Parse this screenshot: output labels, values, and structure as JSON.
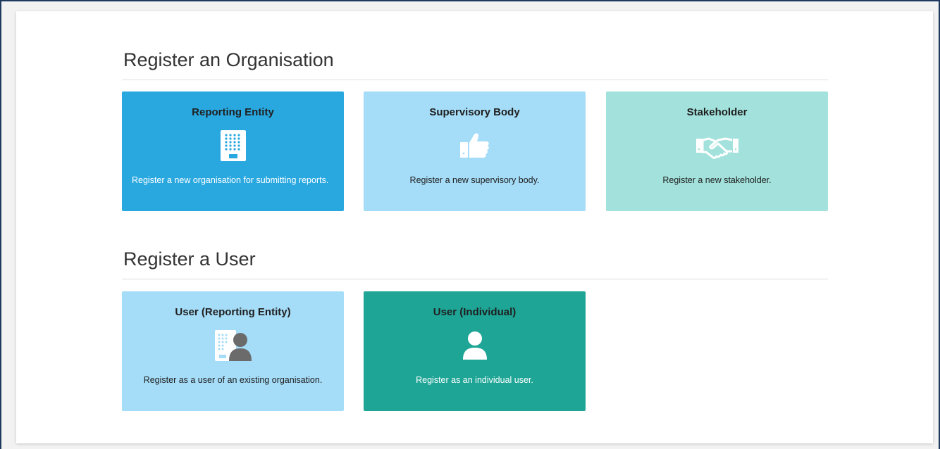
{
  "sections": {
    "organisation": {
      "title": "Register an Organisation",
      "tiles": [
        {
          "title": "Reporting Entity",
          "description": "Register a new organisation for submitting reports.",
          "icon": "building-icon",
          "color": "#29a8e0"
        },
        {
          "title": "Supervisory Body",
          "description": "Register a new supervisory body.",
          "icon": "thumbs-up-icon",
          "color": "#a5dcf7"
        },
        {
          "title": "Stakeholder",
          "description": "Register a new stakeholder.",
          "icon": "handshake-icon",
          "color": "#a3e2dc"
        }
      ]
    },
    "user": {
      "title": "Register a User",
      "tiles": [
        {
          "title": "User (Reporting Entity)",
          "description": "Register as a user of an existing organisation.",
          "icon": "building-user-icon",
          "color": "#a5dcf7"
        },
        {
          "title": "User (Individual)",
          "description": "Register as an individual user.",
          "icon": "user-icon",
          "color": "#1ea596"
        }
      ]
    }
  }
}
